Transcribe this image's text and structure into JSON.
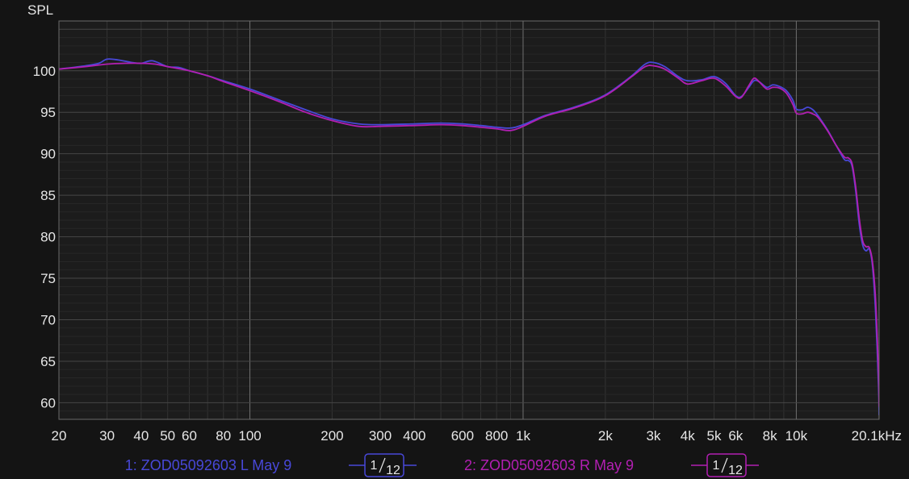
{
  "chart_data": {
    "type": "line",
    "ylabel": "SPL",
    "xlabel": "",
    "xscale": "log",
    "xlim": [
      20,
      20100
    ],
    "ylim": [
      58,
      106
    ],
    "grid": true,
    "background": "#141414",
    "plot_background": "#1c1c1c",
    "y_ticks": [
      60,
      65,
      70,
      75,
      80,
      85,
      90,
      95,
      100
    ],
    "x_ticks": [
      {
        "value": 20,
        "label": "20"
      },
      {
        "value": 30,
        "label": "30"
      },
      {
        "value": 40,
        "label": "40"
      },
      {
        "value": 50,
        "label": "50"
      },
      {
        "value": 60,
        "label": "60"
      },
      {
        "value": 80,
        "label": "80"
      },
      {
        "value": 100,
        "label": "100"
      },
      {
        "value": 200,
        "label": "200"
      },
      {
        "value": 300,
        "label": "300"
      },
      {
        "value": 400,
        "label": "400"
      },
      {
        "value": 600,
        "label": "600"
      },
      {
        "value": 800,
        "label": "800"
      },
      {
        "value": 1000,
        "label": "1k"
      },
      {
        "value": 2000,
        "label": "2k"
      },
      {
        "value": 3000,
        "label": "3k"
      },
      {
        "value": 4000,
        "label": "4k"
      },
      {
        "value": 5000,
        "label": "5k"
      },
      {
        "value": 6000,
        "label": "6k"
      },
      {
        "value": 8000,
        "label": "8k"
      },
      {
        "value": 10000,
        "label": "10k"
      },
      {
        "value": 20100,
        "label": "20.1kHz"
      }
    ],
    "series": [
      {
        "name": "1: ZOD05092603 L May 9",
        "color": "#4848d8",
        "smoothing": {
          "numerator": "1",
          "denominator": "12"
        },
        "points": [
          [
            20,
            100.2
          ],
          [
            25,
            100.6
          ],
          [
            28,
            100.9
          ],
          [
            30,
            101.4
          ],
          [
            33,
            101.3
          ],
          [
            37,
            101.0
          ],
          [
            40,
            100.9
          ],
          [
            44,
            101.2
          ],
          [
            50,
            100.5
          ],
          [
            55,
            100.4
          ],
          [
            60,
            100.0
          ],
          [
            70,
            99.4
          ],
          [
            80,
            98.8
          ],
          [
            100,
            97.8
          ],
          [
            130,
            96.4
          ],
          [
            160,
            95.3
          ],
          [
            200,
            94.2
          ],
          [
            250,
            93.6
          ],
          [
            300,
            93.5
          ],
          [
            400,
            93.6
          ],
          [
            500,
            93.7
          ],
          [
            600,
            93.6
          ],
          [
            700,
            93.4
          ],
          [
            800,
            93.2
          ],
          [
            900,
            93.1
          ],
          [
            1000,
            93.5
          ],
          [
            1200,
            94.6
          ],
          [
            1500,
            95.5
          ],
          [
            1800,
            96.4
          ],
          [
            2000,
            97.1
          ],
          [
            2200,
            98.0
          ],
          [
            2500,
            99.4
          ],
          [
            2800,
            100.8
          ],
          [
            3000,
            101.0
          ],
          [
            3300,
            100.5
          ],
          [
            3700,
            99.3
          ],
          [
            4000,
            98.8
          ],
          [
            4500,
            98.9
          ],
          [
            5000,
            99.3
          ],
          [
            5500,
            98.5
          ],
          [
            6000,
            97.0
          ],
          [
            6300,
            96.9
          ],
          [
            6700,
            98.0
          ],
          [
            7000,
            98.8
          ],
          [
            7300,
            98.7
          ],
          [
            7800,
            98.0
          ],
          [
            8200,
            98.3
          ],
          [
            8700,
            98.1
          ],
          [
            9200,
            97.6
          ],
          [
            9700,
            96.5
          ],
          [
            10000,
            95.4
          ],
          [
            10500,
            95.3
          ],
          [
            11000,
            95.6
          ],
          [
            11500,
            95.3
          ],
          [
            12000,
            94.6
          ],
          [
            13000,
            92.9
          ],
          [
            14000,
            91.0
          ],
          [
            15000,
            89.3
          ],
          [
            15500,
            89.2
          ],
          [
            16000,
            88.5
          ],
          [
            16500,
            85.5
          ],
          [
            17000,
            81.5
          ],
          [
            17500,
            79.0
          ],
          [
            18000,
            78.3
          ],
          [
            18500,
            78.5
          ],
          [
            19000,
            76.5
          ],
          [
            19500,
            71.0
          ],
          [
            20000,
            62.0
          ],
          [
            20100,
            58.5
          ]
        ]
      },
      {
        "name": "2: ZOD05092603 R May 9",
        "color": "#b21fb2",
        "smoothing": {
          "numerator": "1",
          "denominator": "12"
        },
        "points": [
          [
            20,
            100.2
          ],
          [
            25,
            100.5
          ],
          [
            30,
            100.8
          ],
          [
            35,
            100.9
          ],
          [
            40,
            100.9
          ],
          [
            45,
            100.8
          ],
          [
            50,
            100.5
          ],
          [
            60,
            100.0
          ],
          [
            70,
            99.4
          ],
          [
            80,
            98.7
          ],
          [
            100,
            97.6
          ],
          [
            130,
            96.2
          ],
          [
            160,
            95.0
          ],
          [
            200,
            94.0
          ],
          [
            250,
            93.3
          ],
          [
            300,
            93.3
          ],
          [
            400,
            93.4
          ],
          [
            500,
            93.5
          ],
          [
            600,
            93.4
          ],
          [
            700,
            93.2
          ],
          [
            800,
            93.0
          ],
          [
            900,
            92.8
          ],
          [
            1000,
            93.3
          ],
          [
            1200,
            94.5
          ],
          [
            1500,
            95.4
          ],
          [
            1800,
            96.3
          ],
          [
            2000,
            97.0
          ],
          [
            2200,
            97.9
          ],
          [
            2500,
            99.3
          ],
          [
            2800,
            100.5
          ],
          [
            3000,
            100.6
          ],
          [
            3300,
            100.2
          ],
          [
            3700,
            99.1
          ],
          [
            4000,
            98.4
          ],
          [
            4500,
            98.8
          ],
          [
            5000,
            99.1
          ],
          [
            5500,
            98.2
          ],
          [
            6000,
            96.9
          ],
          [
            6300,
            96.8
          ],
          [
            6700,
            98.2
          ],
          [
            7000,
            99.1
          ],
          [
            7300,
            98.7
          ],
          [
            7800,
            97.8
          ],
          [
            8200,
            98.0
          ],
          [
            8700,
            97.9
          ],
          [
            9200,
            97.3
          ],
          [
            9700,
            96.0
          ],
          [
            10000,
            94.9
          ],
          [
            10500,
            94.8
          ],
          [
            11000,
            95.0
          ],
          [
            11500,
            94.8
          ],
          [
            12000,
            94.4
          ],
          [
            13000,
            92.8
          ],
          [
            14000,
            91.0
          ],
          [
            15000,
            89.6
          ],
          [
            15500,
            89.5
          ],
          [
            16000,
            88.8
          ],
          [
            16500,
            86.0
          ],
          [
            17000,
            82.2
          ],
          [
            17500,
            79.5
          ],
          [
            18000,
            78.8
          ],
          [
            18500,
            78.7
          ],
          [
            19000,
            77.0
          ],
          [
            19500,
            72.5
          ],
          [
            20000,
            63.5
          ],
          [
            20100,
            59.5
          ]
        ]
      }
    ]
  }
}
